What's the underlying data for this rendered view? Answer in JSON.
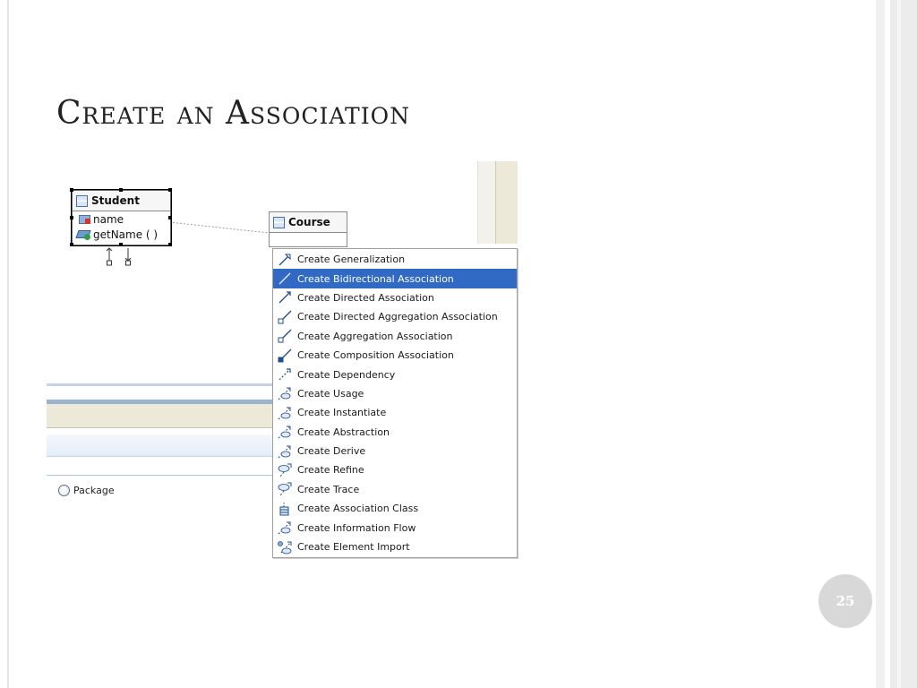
{
  "slide": {
    "title": "Create an Association",
    "page_number": "25"
  },
  "diagram": {
    "student": {
      "name": "Student",
      "attribute": "name",
      "operation": "getName ( )"
    },
    "course": {
      "name": "Course"
    }
  },
  "panel": {
    "radio_label": "Package"
  },
  "context_menu": {
    "highlight_color": "#316ac5",
    "items": [
      {
        "label": "Create Generalization",
        "icon": "generalization-icon"
      },
      {
        "label": "Create Bidirectional Association",
        "icon": "bidirectional-association-icon",
        "highlighted": true
      },
      {
        "label": "Create Directed Association",
        "icon": "directed-association-icon"
      },
      {
        "label": "Create Directed Aggregation Association",
        "icon": "directed-aggregation-icon"
      },
      {
        "label": "Create Aggregation Association",
        "icon": "aggregation-icon"
      },
      {
        "label": "Create Composition Association",
        "icon": "composition-icon"
      },
      {
        "label": "Create Dependency",
        "icon": "dependency-icon"
      },
      {
        "label": "Create Usage",
        "icon": "usage-icon"
      },
      {
        "label": "Create Instantiate",
        "icon": "instantiate-icon"
      },
      {
        "label": "Create Abstraction",
        "icon": "abstraction-icon"
      },
      {
        "label": "Create Derive",
        "icon": "derive-icon"
      },
      {
        "label": "Create Refine",
        "icon": "refine-icon"
      },
      {
        "label": "Create Trace",
        "icon": "trace-icon"
      },
      {
        "label": "Create Association Class",
        "icon": "association-class-icon"
      },
      {
        "label": "Create Information Flow",
        "icon": "information-flow-icon"
      },
      {
        "label": "Create Element Import",
        "icon": "element-import-icon"
      }
    ]
  }
}
